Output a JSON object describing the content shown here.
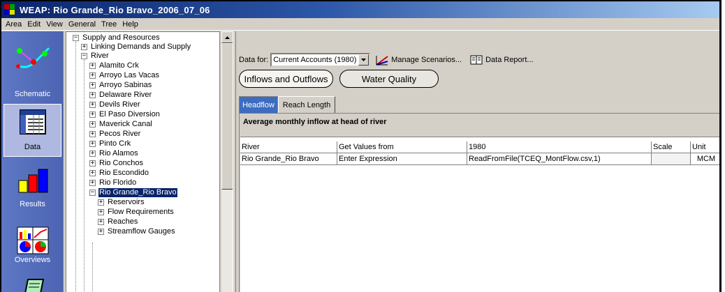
{
  "window": {
    "title": "WEAP: Rio Grande_Rio Bravo_2006_07_06"
  },
  "menu": [
    "Area",
    "Edit",
    "View",
    "General",
    "Tree",
    "Help"
  ],
  "views": [
    {
      "label": "Schematic",
      "icon": "schematic-icon"
    },
    {
      "label": "Data",
      "icon": "data-icon",
      "selected": true
    },
    {
      "label": "Results",
      "icon": "results-chart-icon"
    },
    {
      "label": "Overviews",
      "icon": "overviews-icon"
    }
  ],
  "tree": {
    "root": "Supply and Resources",
    "linking": "Linking Demands and Supply",
    "river_group": "River",
    "rivers": [
      "Alamito Crk",
      "Arroyo Las Vacas",
      "Arroyo Sabinas",
      "Delaware River",
      "Devils River",
      "El Paso Diversion",
      "Maverick Canal",
      "Pecos River",
      "Pinto Crk",
      "Rio Alamos",
      "Rio Conchos",
      "Rio Escondido",
      "Rio Florido"
    ],
    "selected": "Rio Grande_Rio Bravo",
    "children": [
      "Reservoirs",
      "Flow Requirements",
      "Reaches",
      "Streamflow Gauges"
    ]
  },
  "toolbar": {
    "data_for_label": "Data for:",
    "scenario_value": "Current Accounts (1980)",
    "manage_scenarios": "Manage Scenarios...",
    "data_report": "Data Report..."
  },
  "tabs": {
    "main": [
      "Inflows and Outflows",
      "Water Quality"
    ],
    "sub": [
      "Headflow",
      "Reach Length"
    ]
  },
  "panel": {
    "title": "Average monthly inflow at head of river",
    "columns": [
      "River",
      "Get Values from",
      "1980",
      "Scale",
      "Unit"
    ],
    "rows": [
      [
        "Rio Grande_Rio Bravo",
        "Enter Expression",
        "ReadFromFile(TCEQ_MontFlow.csv,1)",
        "",
        "MCM"
      ]
    ]
  },
  "colors": {
    "title_gradient_start": "#0a246a",
    "views_bar": "#5d78c4",
    "selected_tab": "#3d6cc0",
    "tree_selection": "#0a246a"
  }
}
